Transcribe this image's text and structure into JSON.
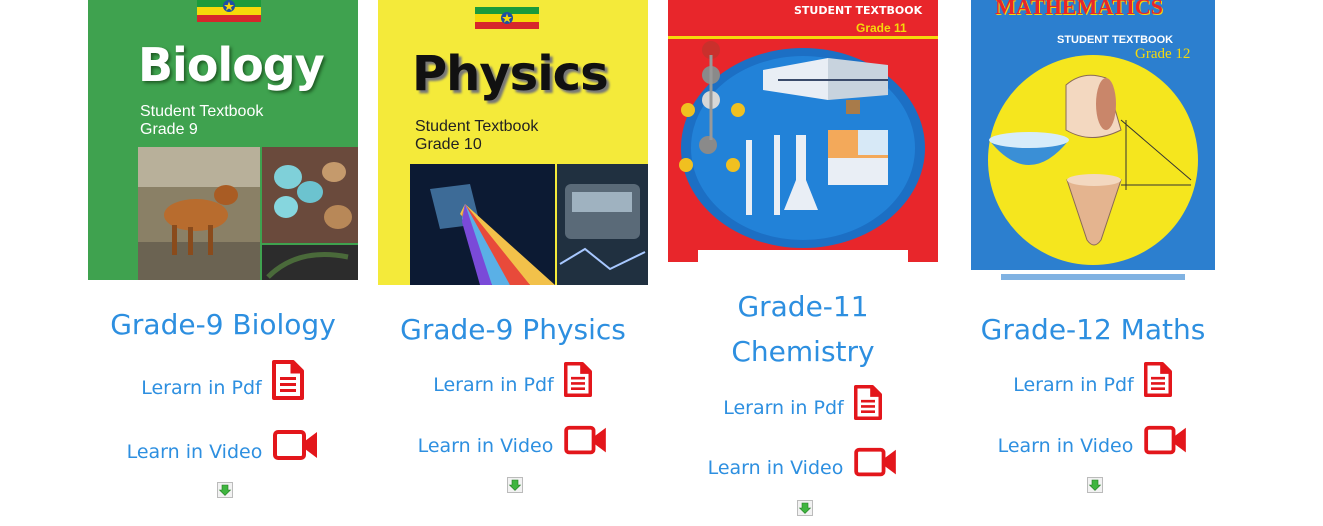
{
  "books": [
    {
      "id": "biology",
      "cover": {
        "title": "Biology",
        "subtitle_line1": "Student Textbook",
        "subtitle_line2": "Grade 9"
      },
      "title": "Grade-9 Biology",
      "pdf_label": "Lerarn in Pdf",
      "video_label": "Learn in Video",
      "pdf_icon": "file-text-icon",
      "video_icon": "video-camera-icon",
      "download_icon": "download-arrow-icon"
    },
    {
      "id": "physics",
      "cover": {
        "title": "Physics",
        "subtitle_line1": "Student Textbook",
        "subtitle_line2": "Grade 10"
      },
      "title": "Grade-9 Physics",
      "pdf_label": "Lerarn in Pdf",
      "video_label": "Learn in Video",
      "pdf_icon": "file-text-icon",
      "video_icon": "video-camera-icon",
      "download_icon": "download-arrow-icon"
    },
    {
      "id": "chemistry",
      "cover": {
        "title": "STUDENT TEXTBOOK",
        "subtitle_line1": "Grade 11",
        "subtitle_line2": ""
      },
      "title_line1": "Grade-11",
      "title_line2": "Chemistry",
      "pdf_label": "Lerarn in Pdf",
      "video_label": "Learn in Video",
      "pdf_icon": "file-text-icon",
      "video_icon": "video-camera-icon",
      "download_icon": "download-arrow-icon"
    },
    {
      "id": "maths",
      "cover": {
        "title": "MATHEMATICS",
        "subtitle_line1": "STUDENT TEXTBOOK",
        "subtitle_line2": "Grade 12"
      },
      "title": "Grade-12 Maths",
      "pdf_label": "Lerarn in Pdf",
      "video_label": "Learn in Video",
      "pdf_icon": "file-text-icon",
      "video_icon": "video-camera-icon",
      "download_icon": "download-arrow-icon"
    }
  ],
  "colors": {
    "link": "#2d8fe0",
    "icon_red": "#e3161b",
    "biology_green": "#3fa24f",
    "physics_yellow": "#f4ea3a",
    "chemistry_red": "#e8262b",
    "maths_blue": "#2c7fcf"
  }
}
